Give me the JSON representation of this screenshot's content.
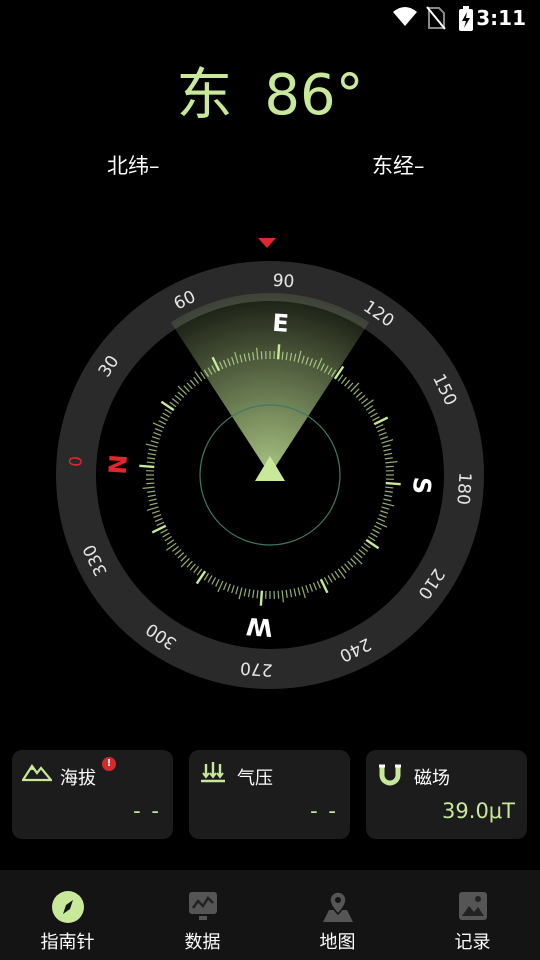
{
  "status_bar": {
    "time": "3:11"
  },
  "heading": {
    "direction": "东",
    "degrees": "86°"
  },
  "coordinates": {
    "latitude_label": "北纬–",
    "longitude_label": "东经–"
  },
  "compass": {
    "heading_value": 86,
    "outer_ring_labels": [
      "0",
      "30",
      "60",
      "90",
      "120",
      "150",
      "180",
      "210",
      "240",
      "270",
      "300",
      "330"
    ],
    "cardinal_labels": {
      "north": "N",
      "east": "E",
      "south": "S",
      "west": "W"
    },
    "colors": {
      "accent": "#c8e89a",
      "north": "#e0262e",
      "ring": "#2a2a2a"
    }
  },
  "cards": [
    {
      "icon": "mountain-icon",
      "label": "海拔",
      "value": "- -",
      "badge": "!"
    },
    {
      "icon": "pressure-icon",
      "label": "气压",
      "value": "- -"
    },
    {
      "icon": "magnet-icon",
      "label": "磁场",
      "value": "39.0μT"
    }
  ],
  "nav": [
    {
      "icon": "compass-icon",
      "label": "指南针",
      "active": true
    },
    {
      "icon": "chart-icon",
      "label": "数据"
    },
    {
      "icon": "map-pin-icon",
      "label": "地图"
    },
    {
      "icon": "gallery-icon",
      "label": "记录"
    }
  ]
}
